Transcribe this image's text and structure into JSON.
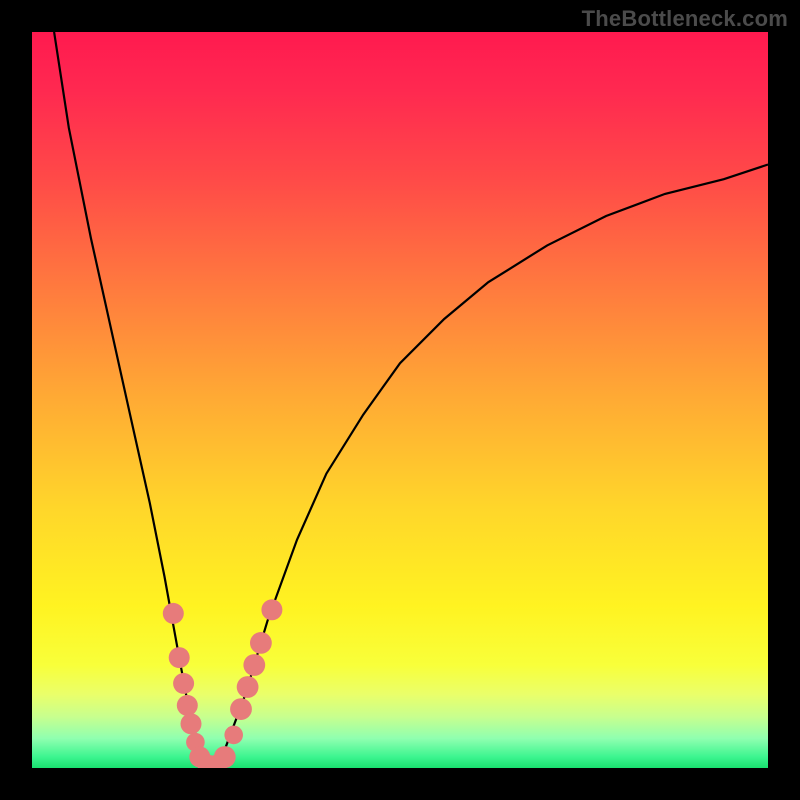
{
  "watermark": {
    "text": "TheBottleneck.com"
  },
  "colors": {
    "frame": "#000000",
    "curve_stroke": "#000000",
    "bead_fill": "#e77b7b",
    "gradient_stops": [
      {
        "offset": 0.0,
        "color": "#ff1a4f"
      },
      {
        "offset": 0.08,
        "color": "#ff2950"
      },
      {
        "offset": 0.2,
        "color": "#ff4a48"
      },
      {
        "offset": 0.35,
        "color": "#ff7b3e"
      },
      {
        "offset": 0.5,
        "color": "#ffab34"
      },
      {
        "offset": 0.65,
        "color": "#ffd72a"
      },
      {
        "offset": 0.78,
        "color": "#fff321"
      },
      {
        "offset": 0.86,
        "color": "#f8ff3a"
      },
      {
        "offset": 0.9,
        "color": "#eaff6a"
      },
      {
        "offset": 0.93,
        "color": "#c8ff8e"
      },
      {
        "offset": 0.96,
        "color": "#8fffb0"
      },
      {
        "offset": 0.985,
        "color": "#3cf58f"
      },
      {
        "offset": 1.0,
        "color": "#19e06f"
      }
    ]
  },
  "chart_data": {
    "type": "line",
    "title": "",
    "xlabel": "",
    "ylabel": "",
    "xlim": [
      0,
      100
    ],
    "ylim": [
      0,
      100
    ],
    "grid": false,
    "legend": false,
    "series": [
      {
        "name": "bottleneck-curve",
        "x": [
          3,
          5,
          8,
          10,
          12,
          14,
          16,
          18,
          20,
          21.5,
          23,
          24.5,
          26,
          29,
          32,
          36,
          40,
          45,
          50,
          56,
          62,
          70,
          78,
          86,
          94,
          100
        ],
        "y": [
          100,
          87,
          72,
          63,
          54,
          45,
          36,
          26,
          15,
          7,
          2,
          0,
          2,
          10,
          20,
          31,
          40,
          48,
          55,
          61,
          66,
          71,
          75,
          78,
          80,
          82
        ]
      }
    ],
    "beads": {
      "name": "highlight-beads",
      "points": [
        {
          "x": 19.2,
          "y": 21,
          "r": 1.6
        },
        {
          "x": 20.0,
          "y": 15,
          "r": 1.6
        },
        {
          "x": 20.6,
          "y": 11.5,
          "r": 1.6
        },
        {
          "x": 21.1,
          "y": 8.5,
          "r": 1.6
        },
        {
          "x": 21.6,
          "y": 6.0,
          "r": 1.6
        },
        {
          "x": 22.2,
          "y": 3.5,
          "r": 1.3
        },
        {
          "x": 22.8,
          "y": 1.5,
          "r": 1.6
        },
        {
          "x": 24.0,
          "y": 0.3,
          "r": 1.7
        },
        {
          "x": 25.0,
          "y": 0.3,
          "r": 1.7
        },
        {
          "x": 26.2,
          "y": 1.5,
          "r": 1.7
        },
        {
          "x": 27.4,
          "y": 4.5,
          "r": 1.3
        },
        {
          "x": 28.4,
          "y": 8.0,
          "r": 1.7
        },
        {
          "x": 29.3,
          "y": 11.0,
          "r": 1.7
        },
        {
          "x": 30.2,
          "y": 14.0,
          "r": 1.7
        },
        {
          "x": 31.1,
          "y": 17.0,
          "r": 1.7
        },
        {
          "x": 32.6,
          "y": 21.5,
          "r": 1.6
        }
      ]
    }
  }
}
